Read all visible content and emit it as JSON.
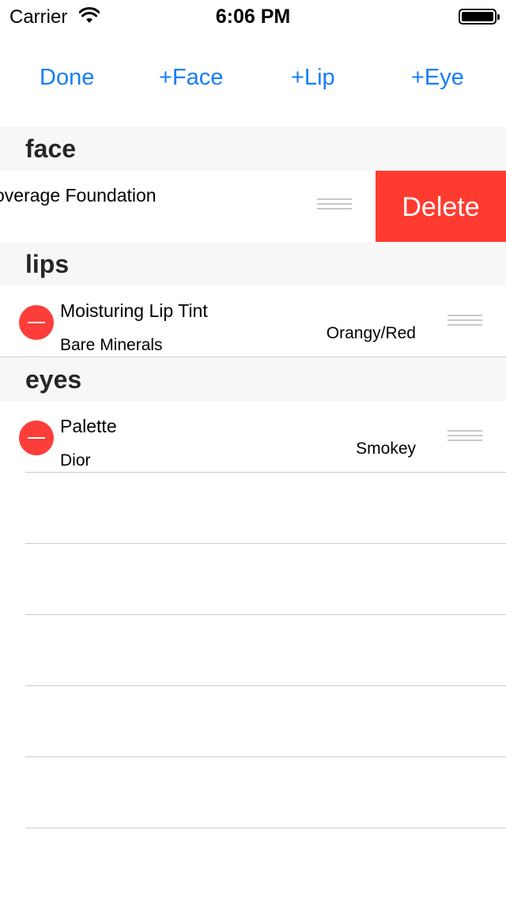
{
  "status_bar": {
    "carrier": "Carrier",
    "time": "6:06 PM",
    "icons": [
      "wifi-icon",
      "battery-icon"
    ]
  },
  "toolbar": {
    "done_label": "Done",
    "add_face_label": "+Face",
    "add_lip_label": "+Lip",
    "add_eye_label": "+Eye",
    "accent_color": "#157efb"
  },
  "sections": {
    "face": {
      "header": "face",
      "row": {
        "title": "overage Foundation",
        "delete_label": "Delete"
      }
    },
    "lips": {
      "header": "lips",
      "row": {
        "title": "Moisturing Lip Tint",
        "brand": "Bare Minerals",
        "shade": "Orangy/Red"
      }
    },
    "eyes": {
      "header": "eyes",
      "row": {
        "title": "Palette",
        "brand": "Dior",
        "shade": "Smokey"
      }
    }
  },
  "colors": {
    "delete_red": "#ff3b30",
    "section_bg": "#f7f7f7"
  }
}
